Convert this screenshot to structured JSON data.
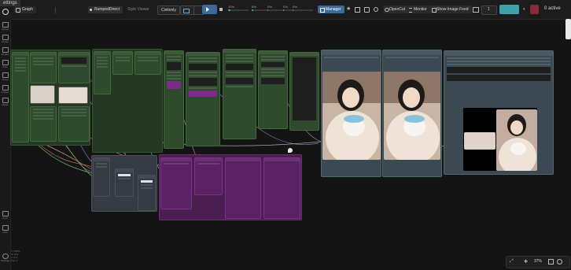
{
  "header": {
    "settings_label": "ettings",
    "graph_tab": "Graph",
    "workflow_tab": "RumpedDirect",
    "viewer_tab": "Style Viewer",
    "quality_select": "Civitonly",
    "zoom_values": [
      "10%",
      "8%",
      "0%",
      "0%",
      "5%"
    ],
    "progress_fill": [
      0.12,
      0.08,
      0.02,
      0.02,
      0.05
    ],
    "manager_label": "Manager",
    "opencut_label": "OpenCut",
    "monitor_label": "Monitor",
    "show_image_feed_label": "Show Image Feed",
    "counter_value": "1",
    "active_label": "0 active"
  },
  "sidebar": {
    "items": [
      "Queue",
      "Nodes",
      "Models",
      "Flow",
      "Templ",
      "Images",
      "Media"
    ],
    "bottom": [
      "Keys",
      "Help",
      "Settings"
    ]
  },
  "status": {
    "lines": [
      "T: 0.8Pts",
      "N: 0ms",
      "V: 0.0",
      "Fps: 0"
    ]
  },
  "canvas_controls": {
    "zoom_label": "37%"
  },
  "colors": {
    "accent_blue": "#3d6a9a",
    "node_green": "#2f4a2c",
    "node_purple": "#4a1f50",
    "node_gray": "#353b40"
  }
}
